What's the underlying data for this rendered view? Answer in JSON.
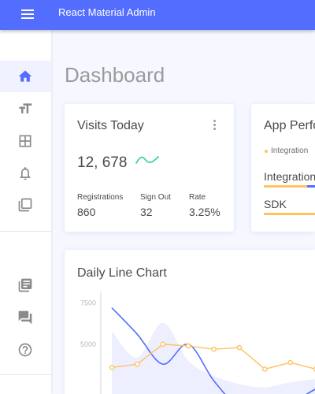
{
  "header": {
    "title": "React Material Admin"
  },
  "sidebar": {
    "items": [
      {
        "icon": "home-icon",
        "active": true
      },
      {
        "icon": "typography-icon"
      },
      {
        "icon": "tables-icon"
      },
      {
        "icon": "notifications-icon"
      },
      {
        "icon": "ui-elements-icon"
      },
      {
        "icon": "library-icon"
      },
      {
        "icon": "support-icon"
      },
      {
        "icon": "faq-icon"
      }
    ]
  },
  "page": {
    "title": "Dashboard"
  },
  "visits_card": {
    "title": "Visits Today",
    "value": "12, 678",
    "stats": [
      {
        "label": "Registrations",
        "value": "860"
      },
      {
        "label": "Sign Out",
        "value": "32"
      },
      {
        "label": "Rate",
        "value": "3.25%"
      }
    ],
    "trend_color": "#3cd4a0"
  },
  "performance_card": {
    "title": "App Perfo",
    "legend": "Integration",
    "bars": [
      {
        "label": "Integration",
        "value": 0.78,
        "color": "#ffc260",
        "color2": "#536dfe"
      },
      {
        "label": "SDK",
        "value": 0.96,
        "color": "#ffc260"
      }
    ]
  },
  "line_chart_card": {
    "title": "Daily Line Chart"
  },
  "colors": {
    "primary": "#536dfe",
    "warning": "#ffc260",
    "success": "#3cd4a0"
  },
  "chart_data": {
    "type": "line",
    "title": "Daily Line Chart",
    "y_ticks": [
      "7500",
      "5000"
    ],
    "ylim": [
      2000,
      7800
    ],
    "series": [
      {
        "color": "#536dfe",
        "values": [
          7200,
          5600,
          3800,
          5000,
          2800,
          1200,
          900,
          1400,
          2300,
          2800
        ]
      },
      {
        "color": "#ffc260",
        "values": [
          3600,
          3800,
          5000,
          4900,
          4700,
          4800,
          3500,
          3900,
          3500,
          3400
        ]
      },
      {
        "color": "#e8ebff",
        "values": [
          5800,
          4200,
          6300,
          4000,
          3100,
          2600,
          2400,
          2700,
          2900,
          3000
        ]
      }
    ]
  }
}
